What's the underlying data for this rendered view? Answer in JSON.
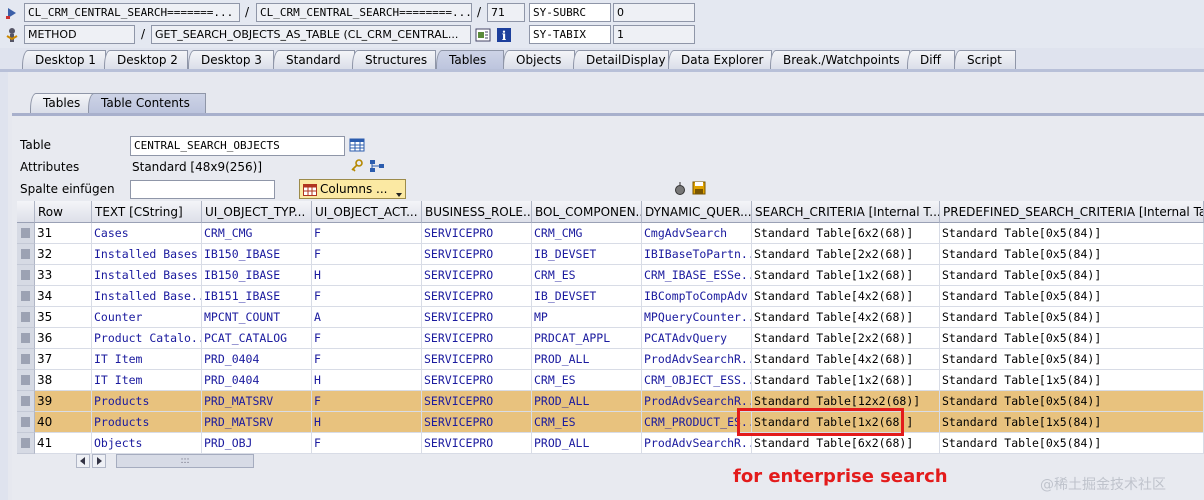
{
  "topbar": {
    "row1": {
      "program_1": "CL_CRM_CENTRAL_SEARCH=======...",
      "program_2": "CL_CRM_CENTRAL_SEARCH========...",
      "line": "71",
      "var_name": "SY-SUBRC",
      "var_value": "0"
    },
    "row2": {
      "event_type": "METHOD",
      "event_name": "GET_SEARCH_OBJECTS_AS_TABLE (CL_CRM_CENTRAL...",
      "var_name": "SY-TABIX",
      "var_value": "1"
    },
    "separator": "/"
  },
  "tabs": [
    "Desktop 1",
    "Desktop 2",
    "Desktop 3",
    "Standard",
    "Structures",
    "Tables",
    "Objects",
    "DetailDisplay",
    "Data Explorer",
    "Break./Watchpoints",
    "Diff",
    "Script"
  ],
  "active_tab": "Tables",
  "subtabs": [
    "Tables",
    "Table Contents"
  ],
  "form": {
    "table_label": "Table",
    "table_value": "CENTRAL_SEARCH_OBJECTS",
    "attributes_label": "Attributes",
    "attributes_value": "Standard [48x9(256)]",
    "insert_column_label": "Spalte einfügen",
    "insert_column_value": "",
    "columns_button": "Columns ..."
  },
  "grid": {
    "columns": [
      "Row",
      "TEXT [CString]",
      "UI_OBJECT_TYP...",
      "UI_OBJECT_ACT...",
      "BUSINESS_ROLE...",
      "BOL_COMPONEN...",
      "DYNAMIC_QUER...",
      "SEARCH_CRITERIA [Internal T...",
      "PREDEFINED_SEARCH_CRITERIA [Internal Table]"
    ],
    "rows": [
      [
        "31",
        "Cases",
        "CRM_CMG",
        "F",
        "SERVICEPRO",
        "CRM_CMG",
        "CmgAdvSearch",
        "Standard Table[6x2(68)]",
        "Standard Table[0x5(84)]"
      ],
      [
        "32",
        "Installed Bases",
        "IB150_IBASE",
        "F",
        "SERVICEPRO",
        "IB_DEVSET",
        "IBIBaseToPartn...",
        "Standard Table[2x2(68)]",
        "Standard Table[0x5(84)]"
      ],
      [
        "33",
        "Installed Bases",
        "IB150_IBASE",
        "H",
        "SERVICEPRO",
        "CRM_ES",
        "CRM_IBASE_ESSe...",
        "Standard Table[1x2(68)]",
        "Standard Table[0x5(84)]"
      ],
      [
        "34",
        "Installed Base...",
        "IB151_IBASE",
        "F",
        "SERVICEPRO",
        "IB_DEVSET",
        "IBCompToCompAdv",
        "Standard Table[4x2(68)]",
        "Standard Table[0x5(84)]"
      ],
      [
        "35",
        "Counter",
        "MPCNT_COUNT",
        "A",
        "SERVICEPRO",
        "MP",
        "MPQueryCounter...",
        "Standard Table[4x2(68)]",
        "Standard Table[0x5(84)]"
      ],
      [
        "36",
        "Product Catalo...",
        "PCAT_CATALOG",
        "F",
        "SERVICEPRO",
        "PRDCAT_APPL",
        "PCATAdvQuery",
        "Standard Table[2x2(68)]",
        "Standard Table[0x5(84)]"
      ],
      [
        "37",
        "IT Item",
        "PRD_0404",
        "F",
        "SERVICEPRO",
        "PROD_ALL",
        "ProdAdvSearchR...",
        "Standard Table[4x2(68)]",
        "Standard Table[0x5(84)]"
      ],
      [
        "38",
        "IT Item",
        "PRD_0404",
        "H",
        "SERVICEPRO",
        "CRM_ES",
        "CRM_OBJECT_ESS...",
        "Standard Table[1x2(68)]",
        "Standard Table[1x5(84)]"
      ],
      [
        "39",
        "Products",
        "PRD_MATSRV",
        "F",
        "SERVICEPRO",
        "PROD_ALL",
        "ProdAdvSearchR...",
        "Standard Table[12x2(68)]",
        "Standard Table[0x5(84)]"
      ],
      [
        "40",
        "Products",
        "PRD_MATSRV",
        "H",
        "SERVICEPRO",
        "CRM_ES",
        "CRM_PRODUCT_ES...",
        "Standard Table[1x2(68)]",
        "Standard Table[1x5(84)]"
      ],
      [
        "41",
        "Objects",
        "PRD_OBJ",
        "F",
        "SERVICEPRO",
        "PROD_ALL",
        "ProdAdvSearchR...",
        "Standard Table[6x2(68)]",
        "Standard Table[0x5(84)]"
      ]
    ],
    "highlighted_rows": [
      "39",
      "40"
    ],
    "highlight_color": "#e8c27e"
  },
  "annotation": "for enterprise search",
  "watermark": "@稀土掘金技术社区",
  "colors": {
    "annotation": "#e31b1b",
    "cell_text": "#1a1a9e"
  }
}
